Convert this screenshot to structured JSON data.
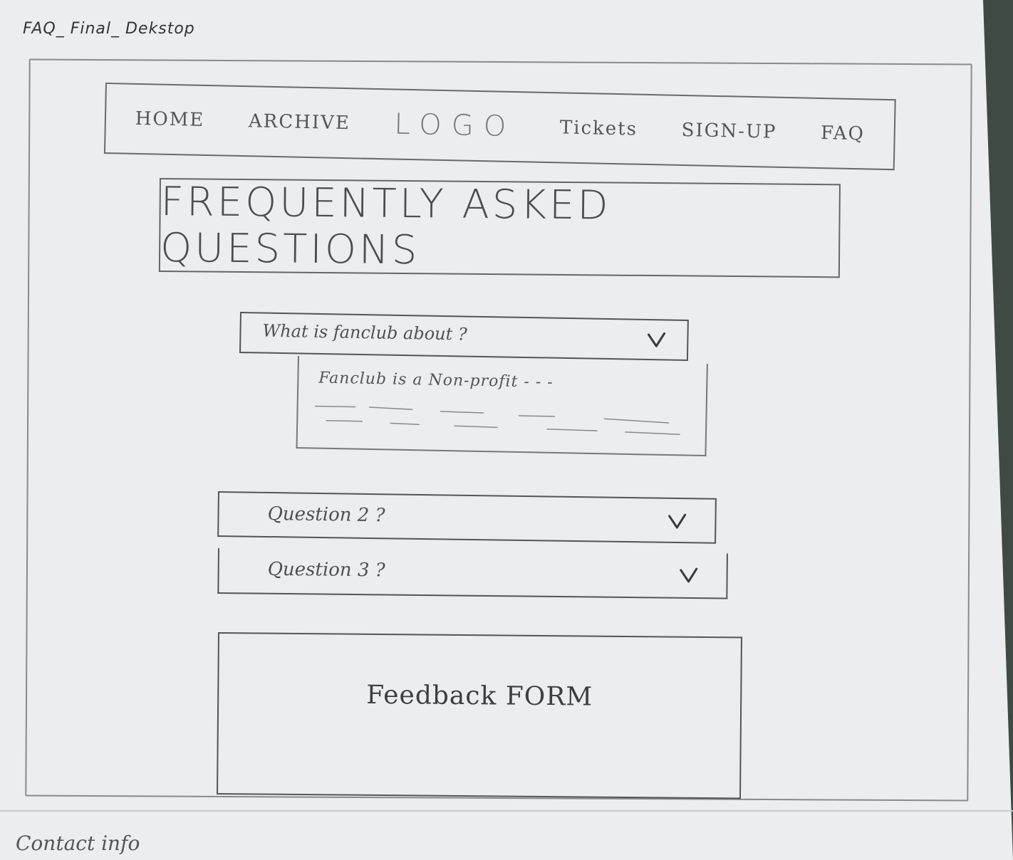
{
  "caption": "FAQ_ Final_ Dekstop",
  "nav": {
    "items": [
      {
        "key": "home",
        "label": "HOME"
      },
      {
        "key": "archive",
        "label": "ARCHIVE"
      },
      {
        "key": "logo",
        "label": "LOGO"
      },
      {
        "key": "tickets",
        "label": "Tickets"
      },
      {
        "key": "signup",
        "label": "SIGN-UP"
      },
      {
        "key": "faq",
        "label": "FAQ"
      }
    ]
  },
  "page_title": "FREQUENTLY ASKED QUESTIONS",
  "faq": {
    "items": [
      {
        "question": "What is fanclub about ?",
        "answer": "Fanclub is a Non-profit - - -",
        "expanded": true,
        "icon": "chevron-down-icon"
      },
      {
        "question": "Question 2 ?",
        "expanded": false,
        "icon": "chevron-down-icon"
      },
      {
        "question": "Question 3 ?",
        "expanded": false,
        "icon": "chevron-down-icon"
      }
    ]
  },
  "feedback": {
    "label": "Feedback FORM"
  },
  "footer": {
    "contact": "Contact info"
  },
  "colors": {
    "paper": "#ecedef",
    "pencil": "#555555",
    "desk": "#3f4a44"
  }
}
